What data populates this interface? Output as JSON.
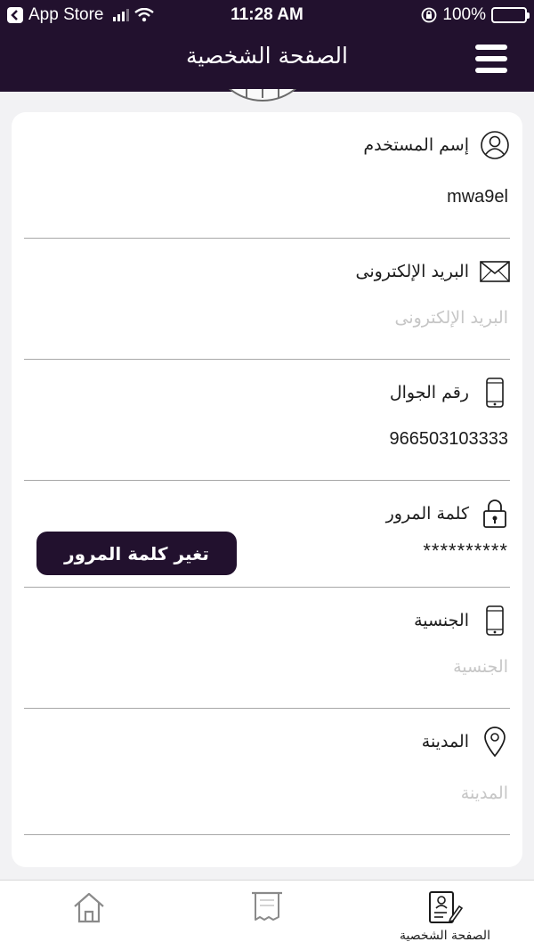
{
  "status_bar": {
    "back_app": "App Store",
    "time": "11:28 AM",
    "battery": "100%"
  },
  "header": {
    "title": "الصفحة الشخصية"
  },
  "profile": {
    "fields": [
      {
        "label": "إسم المستخدم",
        "icon": "user-icon",
        "value": "mwa9el",
        "is_placeholder": false
      },
      {
        "label": "البريد الإلكترونى",
        "icon": "envelope-icon",
        "value": "البريد الإلكترونى",
        "is_placeholder": true
      },
      {
        "label": "رقم الجوال",
        "icon": "phone-icon",
        "value": "966503103333",
        "is_placeholder": false
      },
      {
        "label": "كلمة المرور",
        "icon": "lock-icon",
        "value": "**********",
        "is_placeholder": false
      },
      {
        "label": "الجنسية",
        "icon": "phone-icon",
        "value": "الجنسية",
        "is_placeholder": true
      },
      {
        "label": "المدينة",
        "icon": "location-pin-icon",
        "value": "المدينة",
        "is_placeholder": true
      }
    ],
    "change_password_label": "تغير كلمة المرور"
  },
  "tabbar": {
    "tabs": [
      {
        "icon": "home-icon",
        "label": ""
      },
      {
        "icon": "receipt-icon",
        "label": ""
      },
      {
        "icon": "profile-document-icon",
        "label": "الصفحة الشخصية",
        "active": true
      }
    ]
  },
  "colors": {
    "brand": "#22112e",
    "placeholder": "#c6c6c6",
    "divider": "#a7a7a7"
  }
}
